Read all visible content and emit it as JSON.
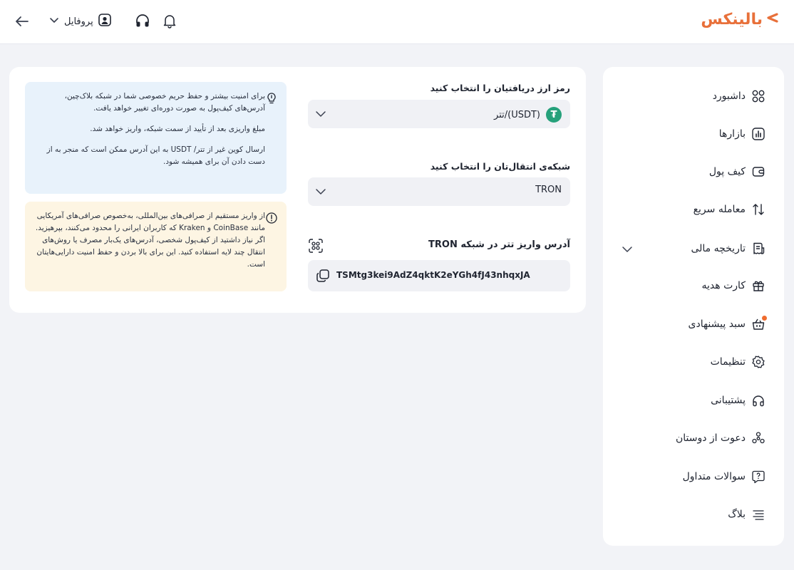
{
  "header": {
    "profile_label": "پروفایل",
    "logo_text": "بالینکس",
    "icons": [
      "arrow-left-icon",
      "chevron-down-icon",
      "user-icon",
      "headset-icon",
      "bell-icon"
    ]
  },
  "sidebar": {
    "items": [
      {
        "label": "داشبورد",
        "icon": "dashboard-grid-icon"
      },
      {
        "label": "بازارها",
        "icon": "market-chart-icon"
      },
      {
        "label": "کیف پول",
        "icon": "wallet-icon"
      },
      {
        "label": "معامله سریع",
        "icon": "swap-arrows-icon"
      },
      {
        "label": "تاریخچه مالی",
        "icon": "history-receipt-icon"
      },
      {
        "label": "کارت هدیه",
        "icon": "gift-icon"
      },
      {
        "label": "سبد پیشنهادی",
        "icon": "basket-icon"
      },
      {
        "label": "تنظیمات",
        "icon": "gear-icon"
      },
      {
        "label": "پشتیبانی",
        "icon": "headset-icon"
      },
      {
        "label": "دعوت از دوستان",
        "icon": "people-icon"
      },
      {
        "label": "سوالات متداول",
        "icon": "question-icon"
      },
      {
        "label": "بلاگ",
        "icon": "menu-lines-icon"
      }
    ]
  },
  "deposit": {
    "currency_title": "رمز ارز دریافتیان را انتخاب کنید",
    "currency_value": "تتر/(USDT)",
    "network_title": "شبکه‌ی انتقال‌تان را انتخاب کنید",
    "network_value": "TRON",
    "address_title": "آدرس واریز تتر در شبکه TRON",
    "address_value": "TSMtg3kei9AdZ4qktK2eYGh4fJ43nhqxJA"
  },
  "info": {
    "blue_paragraphs": [
      "برای امنیت بیشتر و حفظ حریم خصوصی شما در شبکه بلاک‌چین، آدرس‌های کیف‌پول به صورت دوره‌ای تغییر خواهد یافت.",
      "مبلغ واریزی بعد از تأیید از سمت شبکه، واریز خواهد شد.",
      "ارسال کوین غیر از تتر/ USDT به این آدرس ممکن است که منجر به از دست دادن آن برای همیشه شود."
    ],
    "yellow_text": "از واریز مستقیم از صرافی‌های بین‌المللی، به‌خصوص صرافی‌های آمریکایی مانند CoinBase و Kraken که کاربران ایرانی را محدود می‌کنند، بپرهیزید. اگر نیاز داشتید از کیف‌پول شخصی، آدرس‌های یک‌بار مصرف یا روش‌های انتقال چند لایه استفاده کنید. این برای بالا بردن و حفظ امنیت دارایی‌هایتان است."
  },
  "colors": {
    "brand": "#e8703a",
    "usdt": "#26a17b",
    "info_blue_bg": "#e8f2fb",
    "info_yellow_bg": "#fdf5e3",
    "notification_dot": "#ef6c2f"
  }
}
